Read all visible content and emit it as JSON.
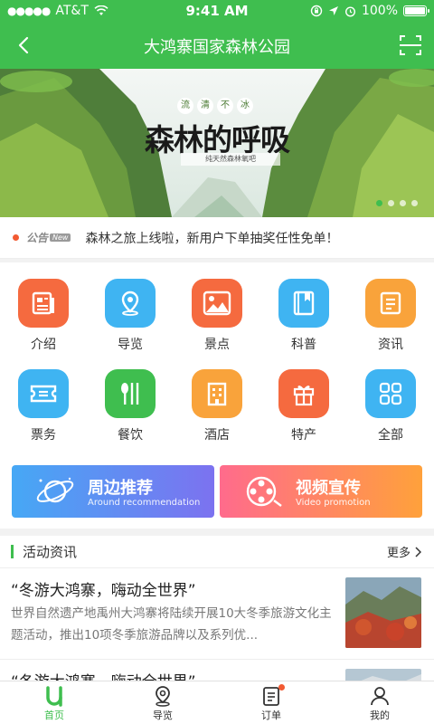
{
  "status_bar": {
    "carrier": "AT&T",
    "time": "9:41 AM",
    "battery": "100%",
    "signal_dots": "●●●●●"
  },
  "nav": {
    "title": "大鸿寨国家森林公园"
  },
  "banner": {
    "seal_chars": [
      "流",
      "清",
      "不",
      "冰"
    ],
    "headline": "森林的呼吸",
    "subtag": "纯天然森林氧吧",
    "slide_count": 4,
    "active_slide": 0
  },
  "notice": {
    "label": "公告",
    "new_tag": "New",
    "text": "森林之旅上线啦，新用户下单抽奖任性免单！"
  },
  "grid": {
    "items": [
      {
        "label": "介绍",
        "icon": "intro-icon",
        "color": "#f56a3f"
      },
      {
        "label": "导览",
        "icon": "location-pin-icon",
        "color": "#3fb4f2"
      },
      {
        "label": "景点",
        "icon": "picture-icon",
        "color": "#f56a3f"
      },
      {
        "label": "科普",
        "icon": "book-icon",
        "color": "#3fb4f2"
      },
      {
        "label": "资讯",
        "icon": "news-icon",
        "color": "#f9a33b"
      },
      {
        "label": "票务",
        "icon": "ticket-icon",
        "color": "#3fb4f2"
      },
      {
        "label": "餐饮",
        "icon": "dining-icon",
        "color": "#3fbe4f"
      },
      {
        "label": "酒店",
        "icon": "hotel-icon",
        "color": "#f9a33b"
      },
      {
        "label": "特产",
        "icon": "gift-icon",
        "color": "#f56a3f"
      },
      {
        "label": "全部",
        "icon": "all-apps-icon",
        "color": "#3fb4f2"
      }
    ]
  },
  "promo": {
    "left": {
      "title": "周边推荐",
      "subtitle": "Around recommendation"
    },
    "right": {
      "title": "视频宣传",
      "subtitle": "Video promotion"
    }
  },
  "activity": {
    "title": "活动资讯",
    "more": "更多",
    "items": [
      {
        "title": "“冬游大鸿寨，嗨动全世界”",
        "desc": "世界自然遗产地禹州大鸿寨将陆续开展10大冬季旅游文化主题活动，推出10项冬季旅游品牌以及系列优..."
      },
      {
        "title": "“冬游大鸿寨，嗨动全世界”",
        "desc": ""
      }
    ]
  },
  "tabbar": {
    "tabs": [
      {
        "label": "首页",
        "icon": "home-logo-icon",
        "active": true
      },
      {
        "label": "导览",
        "icon": "location-pin-icon",
        "active": false
      },
      {
        "label": "订单",
        "icon": "order-icon",
        "active": false,
        "badge": true
      },
      {
        "label": "我的",
        "icon": "user-icon",
        "active": false
      }
    ]
  },
  "colors": {
    "primary": "#3fbe4f",
    "badge": "#f25a32"
  }
}
